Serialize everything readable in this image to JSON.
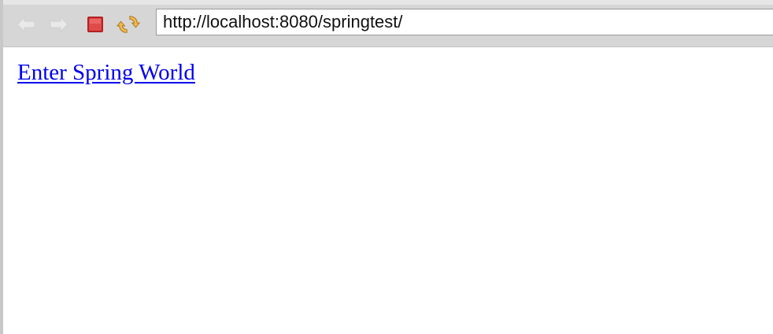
{
  "browser": {
    "toolbar": {
      "back_icon": "back-arrow-icon",
      "forward_icon": "forward-arrow-icon",
      "stop_icon": "stop-icon",
      "refresh_icon": "refresh-icon"
    },
    "address_bar": {
      "url": "http://localhost:8080/springtest/"
    }
  },
  "page": {
    "link_text": "Enter Spring World"
  },
  "colors": {
    "toolbar_bg": "#d6d6d6",
    "link": "#0000ee",
    "stop": "#cc2e2e"
  }
}
